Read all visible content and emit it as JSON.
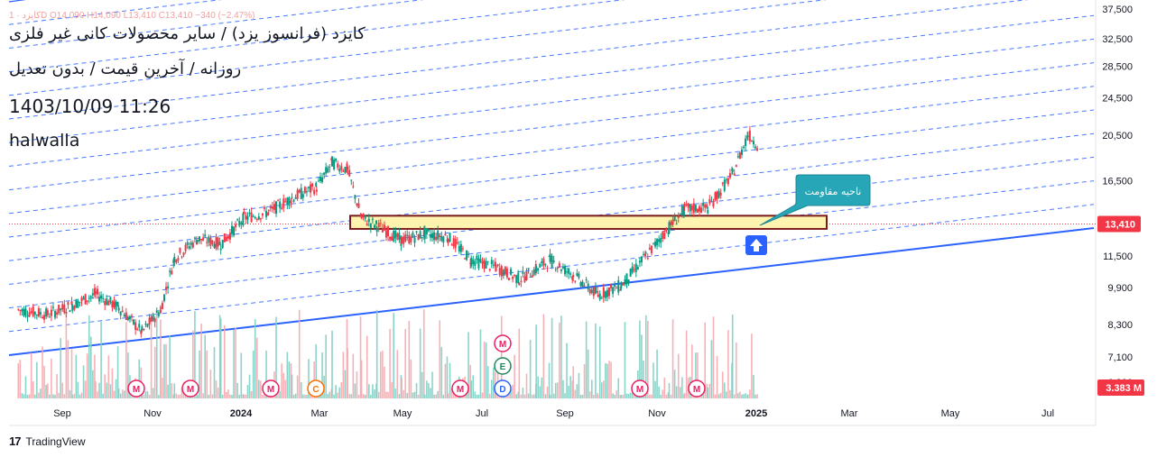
{
  "header": {
    "ohlc_text": "کایزد · 1D  O14,090  H14,090  L13,410  C13,410  −340 (−2.47%)",
    "title_line1": "کایزد (فرانسوز یزد) / سایر محصولات کانی غیر فلزی",
    "title_line2": "روزانه / آخرین قیمت / بدون تعدیل",
    "datetime": "1403/10/09 11:26",
    "author": "halwalla"
  },
  "footer": {
    "logo": "17",
    "brand": "TradingView"
  },
  "annotation": {
    "callout_text": "ناحیه مقاومت"
  },
  "price_badge": {
    "value": "13,410",
    "color": "#f23645"
  },
  "volume_badge": {
    "value": "3.383 M",
    "color": "#f23645"
  },
  "colors": {
    "up": "#089981",
    "down": "#f23645",
    "channel": "#2962ff",
    "zone_fill": "#fff3b0",
    "zone_border": "#7b1a1a",
    "callout": "#26a6b7"
  },
  "chart_data": {
    "type": "candlestick",
    "symbol": "کایزد",
    "interval": "1D",
    "y_scale": "log",
    "yticks": [
      6300,
      7100,
      8300,
      9900,
      11500,
      13410,
      16500,
      20500,
      24500,
      28500,
      32500,
      37500
    ],
    "ytick_labels": [
      "6,300",
      "7,100",
      "8,300",
      "9,900",
      "11,500",
      "13,410",
      "16,500",
      "20,500",
      "24,500",
      "28,500",
      "32,500",
      "37,500"
    ],
    "x_labels": [
      "Sep",
      "Nov",
      "2024",
      "Mar",
      "May",
      "Jul",
      "Sep",
      "Nov",
      "2025",
      "Mar",
      "May",
      "Jul"
    ],
    "last": {
      "open": 14090,
      "high": 14090,
      "low": 13410,
      "close": 13410,
      "change": -340,
      "change_pct": -2.47
    },
    "close_points": [
      {
        "date": "2023-08-01",
        "close": 8900
      },
      {
        "date": "2023-08-20",
        "close": 8700
      },
      {
        "date": "2023-09-05",
        "close": 9100
      },
      {
        "date": "2023-09-20",
        "close": 9600
      },
      {
        "date": "2023-10-05",
        "close": 9000
      },
      {
        "date": "2023-10-20",
        "close": 8000
      },
      {
        "date": "2023-11-01",
        "close": 8900
      },
      {
        "date": "2023-11-10",
        "close": 11400
      },
      {
        "date": "2023-11-25",
        "close": 12500
      },
      {
        "date": "2023-12-10",
        "close": 12200
      },
      {
        "date": "2023-12-25",
        "close": 13800
      },
      {
        "date": "2024-01-10",
        "close": 14200
      },
      {
        "date": "2024-01-25",
        "close": 15200
      },
      {
        "date": "2024-02-10",
        "close": 16000
      },
      {
        "date": "2024-02-20",
        "close": 18000
      },
      {
        "date": "2024-03-01",
        "close": 17400
      },
      {
        "date": "2024-03-10",
        "close": 13800
      },
      {
        "date": "2024-03-20",
        "close": 13300
      },
      {
        "date": "2024-04-05",
        "close": 12400
      },
      {
        "date": "2024-04-20",
        "close": 12800
      },
      {
        "date": "2024-05-05",
        "close": 12600
      },
      {
        "date": "2024-05-20",
        "close": 11300
      },
      {
        "date": "2024-06-05",
        "close": 10900
      },
      {
        "date": "2024-06-20",
        "close": 10300
      },
      {
        "date": "2024-07-01",
        "close": 10800
      },
      {
        "date": "2024-07-10",
        "close": 11300
      },
      {
        "date": "2024-07-25",
        "close": 10500
      },
      {
        "date": "2024-08-10",
        "close": 9550
      },
      {
        "date": "2024-08-25",
        "close": 10000
      },
      {
        "date": "2024-09-10",
        "close": 11500
      },
      {
        "date": "2024-09-25",
        "close": 13200
      },
      {
        "date": "2024-10-05",
        "close": 14400
      },
      {
        "date": "2024-10-20",
        "close": 14500
      },
      {
        "date": "2024-11-05",
        "close": 17000
      },
      {
        "date": "2024-11-15",
        "close": 20600
      },
      {
        "date": "2024-11-25",
        "close": 19000
      },
      {
        "date": "2024-12-05",
        "close": 17000
      },
      {
        "date": "2024-12-15",
        "close": 16300
      },
      {
        "date": "2024-12-22",
        "close": 14600
      },
      {
        "date": "2024-12-29",
        "close": 13410
      }
    ],
    "resistance_zone": {
      "low": 13100,
      "high": 13950,
      "x_start": "2024-03-25",
      "x_end": "2024-12-29"
    },
    "event_markers": [
      "M",
      "M",
      "M",
      "C",
      "M",
      "M",
      "E",
      "D",
      "M",
      "M"
    ],
    "volume_last": "3.383 M"
  }
}
